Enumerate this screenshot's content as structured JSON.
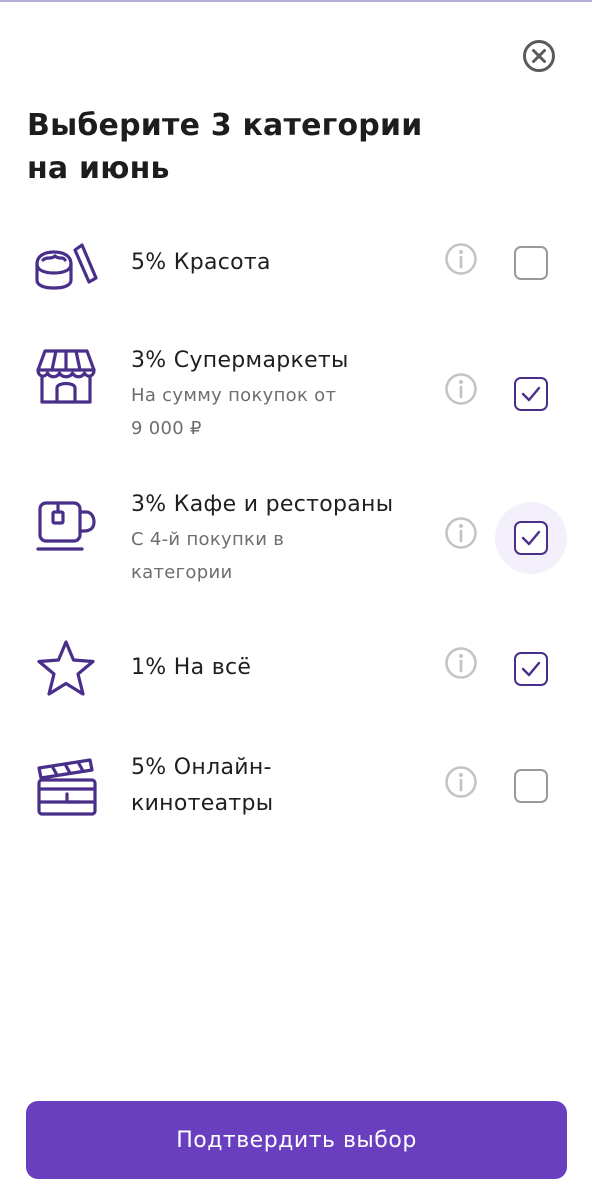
{
  "header": {
    "title_line1": "Выберите 3 категории",
    "title_line2": "на июнь"
  },
  "categories": [
    {
      "icon": "cream-jar-icon",
      "title": "5% Красота",
      "checked": false
    },
    {
      "icon": "store-icon",
      "title": "3% Супермаркеты",
      "subtitle_line1": "На сумму покупок от",
      "subtitle_line2": "9 000 ₽",
      "checked": true
    },
    {
      "icon": "tea-cup-icon",
      "title": "3% Кафе и рестораны",
      "subtitle_line1": "С 4-й покупки в",
      "subtitle_line2": "категории",
      "checked": true,
      "focused": true
    },
    {
      "icon": "star-icon",
      "title": "1% На всё",
      "checked": true
    },
    {
      "icon": "clapperboard-icon",
      "title_line1": "5% Онлайн-",
      "title_line2": "кинотеатры",
      "checked": false
    }
  ],
  "footer": {
    "confirm_label": "Подтвердить выбор"
  },
  "colors": {
    "accent": "#6a3fbf",
    "icon": "#4a2f8a",
    "info": "#c4c4c4",
    "checkbox_unchecked": "#9a9a9a",
    "focus_halo": "#f3f0fb"
  }
}
